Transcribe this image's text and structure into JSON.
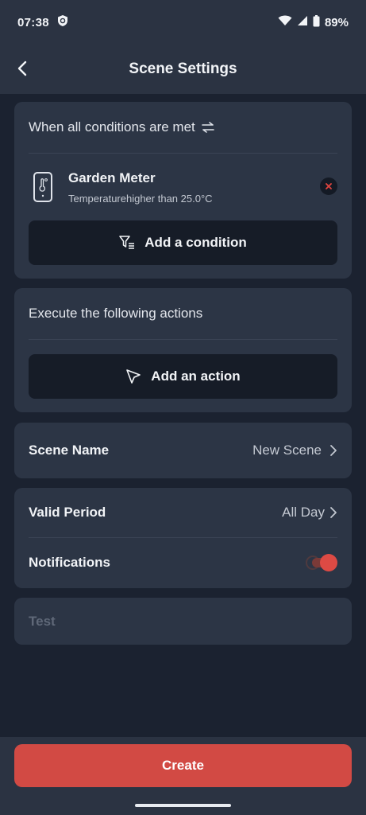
{
  "status_bar": {
    "time": "07:38",
    "battery": "89%",
    "icons": [
      "shield-icon",
      "wifi-icon",
      "signal-icon",
      "battery-icon"
    ]
  },
  "header": {
    "title": "Scene Settings",
    "back_icon": "chevron-left-icon"
  },
  "conditions": {
    "header": "When all conditions are met",
    "header_icon": "swap-arrows-icon",
    "items": [
      {
        "device_icon": "sensor-thermometer-icon",
        "name": "Garden Meter",
        "description": "Temperaturehigher than 25.0°C",
        "remove_icon": "close-icon"
      }
    ],
    "add_label": "Add a condition",
    "add_icon": "filter-add-icon"
  },
  "actions": {
    "header": "Execute the following actions",
    "add_label": "Add an action",
    "add_icon": "cursor-arrow-icon"
  },
  "scene_name": {
    "label": "Scene Name",
    "value": "New Scene"
  },
  "settings": {
    "valid_period_label": "Valid Period",
    "valid_period_value": "All Day",
    "notifications_label": "Notifications",
    "notifications_on": true
  },
  "test": {
    "label": "Test"
  },
  "footer": {
    "create_label": "Create"
  },
  "colors": {
    "background": "#1b2230",
    "card": "#2c3545",
    "accent": "#d24a44"
  }
}
